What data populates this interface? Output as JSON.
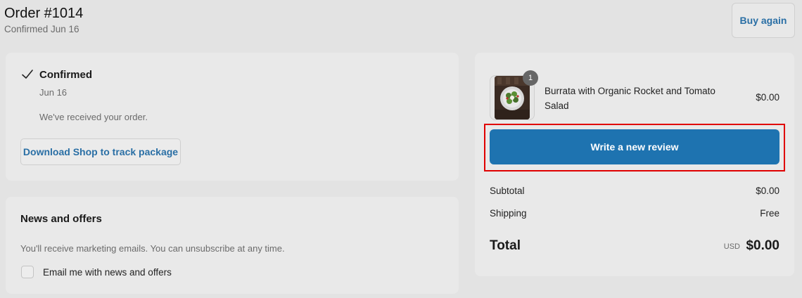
{
  "header": {
    "title": "Order #1014",
    "subtitle": "Confirmed Jun 16",
    "buy_again_label": "Buy again"
  },
  "status_card": {
    "icon": "check-icon",
    "title": "Confirmed",
    "date": "Jun 16",
    "message": "We've received your order.",
    "download_label": "Download Shop to track package"
  },
  "news_card": {
    "title": "News and offers",
    "description": "You'll receive marketing emails. You can unsubscribe at any time.",
    "checkbox_label": "Email me with news and offers",
    "checkbox_checked": false
  },
  "summary": {
    "item": {
      "quantity": "1",
      "name": "Burrata with Organic Rocket and Tomato Salad",
      "price": "$0.00"
    },
    "review_button_label": "Write a new review",
    "subtotal_label": "Subtotal",
    "subtotal_value": "$0.00",
    "shipping_label": "Shipping",
    "shipping_value": "Free",
    "total_label": "Total",
    "total_currency": "USD",
    "total_value": "$0.00"
  },
  "colors": {
    "accent": "#1e73b0",
    "link": "#2a6fa5",
    "highlight": "#e00000"
  }
}
